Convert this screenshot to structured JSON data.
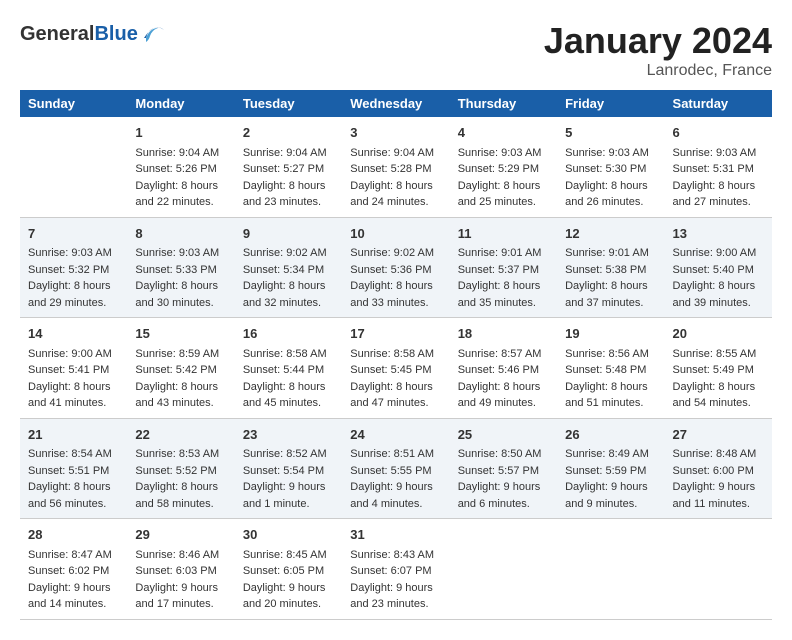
{
  "header": {
    "logo_general": "General",
    "logo_blue": "Blue",
    "title": "January 2024",
    "subtitle": "Lanrodec, France"
  },
  "columns": [
    "Sunday",
    "Monday",
    "Tuesday",
    "Wednesday",
    "Thursday",
    "Friday",
    "Saturday"
  ],
  "weeks": [
    [
      {
        "day": "",
        "content": ""
      },
      {
        "day": "1",
        "content": "Sunrise: 9:04 AM\nSunset: 5:26 PM\nDaylight: 8 hours\nand 22 minutes."
      },
      {
        "day": "2",
        "content": "Sunrise: 9:04 AM\nSunset: 5:27 PM\nDaylight: 8 hours\nand 23 minutes."
      },
      {
        "day": "3",
        "content": "Sunrise: 9:04 AM\nSunset: 5:28 PM\nDaylight: 8 hours\nand 24 minutes."
      },
      {
        "day": "4",
        "content": "Sunrise: 9:03 AM\nSunset: 5:29 PM\nDaylight: 8 hours\nand 25 minutes."
      },
      {
        "day": "5",
        "content": "Sunrise: 9:03 AM\nSunset: 5:30 PM\nDaylight: 8 hours\nand 26 minutes."
      },
      {
        "day": "6",
        "content": "Sunrise: 9:03 AM\nSunset: 5:31 PM\nDaylight: 8 hours\nand 27 minutes."
      }
    ],
    [
      {
        "day": "7",
        "content": "Sunrise: 9:03 AM\nSunset: 5:32 PM\nDaylight: 8 hours\nand 29 minutes."
      },
      {
        "day": "8",
        "content": "Sunrise: 9:03 AM\nSunset: 5:33 PM\nDaylight: 8 hours\nand 30 minutes."
      },
      {
        "day": "9",
        "content": "Sunrise: 9:02 AM\nSunset: 5:34 PM\nDaylight: 8 hours\nand 32 minutes."
      },
      {
        "day": "10",
        "content": "Sunrise: 9:02 AM\nSunset: 5:36 PM\nDaylight: 8 hours\nand 33 minutes."
      },
      {
        "day": "11",
        "content": "Sunrise: 9:01 AM\nSunset: 5:37 PM\nDaylight: 8 hours\nand 35 minutes."
      },
      {
        "day": "12",
        "content": "Sunrise: 9:01 AM\nSunset: 5:38 PM\nDaylight: 8 hours\nand 37 minutes."
      },
      {
        "day": "13",
        "content": "Sunrise: 9:00 AM\nSunset: 5:40 PM\nDaylight: 8 hours\nand 39 minutes."
      }
    ],
    [
      {
        "day": "14",
        "content": "Sunrise: 9:00 AM\nSunset: 5:41 PM\nDaylight: 8 hours\nand 41 minutes."
      },
      {
        "day": "15",
        "content": "Sunrise: 8:59 AM\nSunset: 5:42 PM\nDaylight: 8 hours\nand 43 minutes."
      },
      {
        "day": "16",
        "content": "Sunrise: 8:58 AM\nSunset: 5:44 PM\nDaylight: 8 hours\nand 45 minutes."
      },
      {
        "day": "17",
        "content": "Sunrise: 8:58 AM\nSunset: 5:45 PM\nDaylight: 8 hours\nand 47 minutes."
      },
      {
        "day": "18",
        "content": "Sunrise: 8:57 AM\nSunset: 5:46 PM\nDaylight: 8 hours\nand 49 minutes."
      },
      {
        "day": "19",
        "content": "Sunrise: 8:56 AM\nSunset: 5:48 PM\nDaylight: 8 hours\nand 51 minutes."
      },
      {
        "day": "20",
        "content": "Sunrise: 8:55 AM\nSunset: 5:49 PM\nDaylight: 8 hours\nand 54 minutes."
      }
    ],
    [
      {
        "day": "21",
        "content": "Sunrise: 8:54 AM\nSunset: 5:51 PM\nDaylight: 8 hours\nand 56 minutes."
      },
      {
        "day": "22",
        "content": "Sunrise: 8:53 AM\nSunset: 5:52 PM\nDaylight: 8 hours\nand 58 minutes."
      },
      {
        "day": "23",
        "content": "Sunrise: 8:52 AM\nSunset: 5:54 PM\nDaylight: 9 hours\nand 1 minute."
      },
      {
        "day": "24",
        "content": "Sunrise: 8:51 AM\nSunset: 5:55 PM\nDaylight: 9 hours\nand 4 minutes."
      },
      {
        "day": "25",
        "content": "Sunrise: 8:50 AM\nSunset: 5:57 PM\nDaylight: 9 hours\nand 6 minutes."
      },
      {
        "day": "26",
        "content": "Sunrise: 8:49 AM\nSunset: 5:59 PM\nDaylight: 9 hours\nand 9 minutes."
      },
      {
        "day": "27",
        "content": "Sunrise: 8:48 AM\nSunset: 6:00 PM\nDaylight: 9 hours\nand 11 minutes."
      }
    ],
    [
      {
        "day": "28",
        "content": "Sunrise: 8:47 AM\nSunset: 6:02 PM\nDaylight: 9 hours\nand 14 minutes."
      },
      {
        "day": "29",
        "content": "Sunrise: 8:46 AM\nSunset: 6:03 PM\nDaylight: 9 hours\nand 17 minutes."
      },
      {
        "day": "30",
        "content": "Sunrise: 8:45 AM\nSunset: 6:05 PM\nDaylight: 9 hours\nand 20 minutes."
      },
      {
        "day": "31",
        "content": "Sunrise: 8:43 AM\nSunset: 6:07 PM\nDaylight: 9 hours\nand 23 minutes."
      },
      {
        "day": "",
        "content": ""
      },
      {
        "day": "",
        "content": ""
      },
      {
        "day": "",
        "content": ""
      }
    ]
  ]
}
